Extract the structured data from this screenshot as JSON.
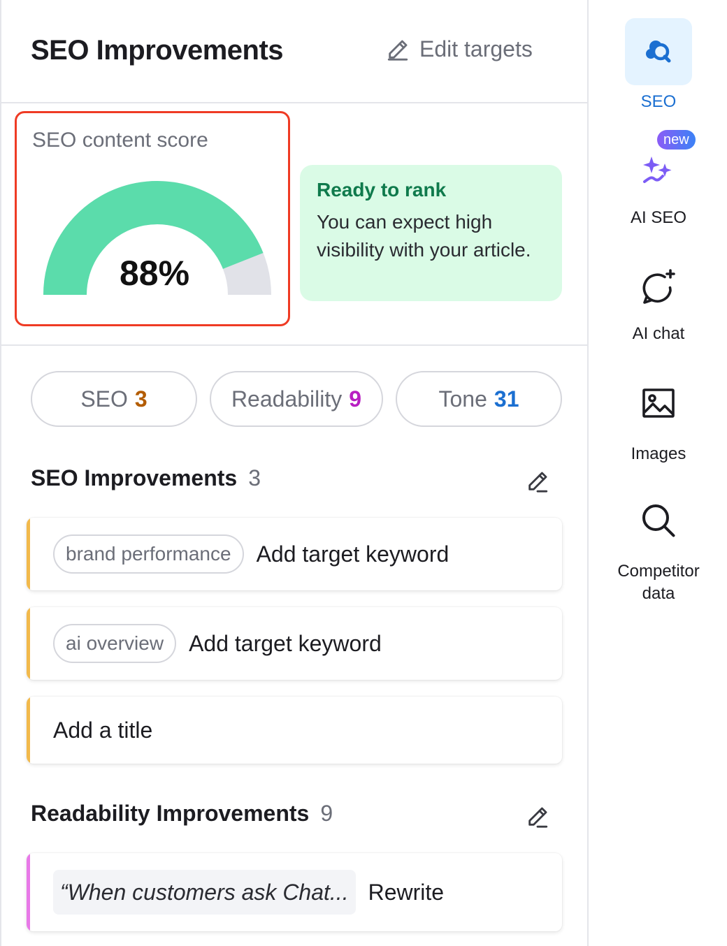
{
  "header": {
    "title": "SEO Improvements",
    "edit_targets_label": "Edit targets"
  },
  "score": {
    "label": "SEO content score",
    "value_text": "88%",
    "value": 0.88,
    "fill_color": "#5bdcab",
    "track_color": "#e1e2e8"
  },
  "rank_card": {
    "title": "Ready to rank",
    "text": "You can expect high visibility with your article."
  },
  "tabs": [
    {
      "label": "SEO",
      "count": "3",
      "count_color": "#b35c00"
    },
    {
      "label": "Readability",
      "count": "9",
      "count_color": "#b81ec2"
    },
    {
      "label": "Tone",
      "count": "31",
      "count_color": "#1b6fd1"
    }
  ],
  "seo_section": {
    "title": "SEO Improvements",
    "count": "3",
    "accent": "#f2b94b",
    "items": [
      {
        "tag": "brand performance",
        "text": "Add target keyword"
      },
      {
        "tag": "ai overview",
        "text": "Add target keyword"
      },
      {
        "text": "Add a title"
      }
    ]
  },
  "readability_section": {
    "title": "Readability Improvements",
    "count": "9",
    "accent": "#e879e8",
    "items": [
      {
        "quote": "“When customers ask Chat...",
        "text": "Rewrite"
      }
    ]
  },
  "sidebar": {
    "items": [
      {
        "label": "SEO",
        "icon": "seo-icon",
        "active": true
      },
      {
        "label": "AI SEO",
        "icon": "sparkles-icon",
        "badge": "new"
      },
      {
        "label": "AI chat",
        "icon": "chat-icon"
      },
      {
        "label": "Images",
        "icon": "image-icon"
      },
      {
        "label": "Competitor data",
        "icon": "search-icon"
      }
    ]
  }
}
